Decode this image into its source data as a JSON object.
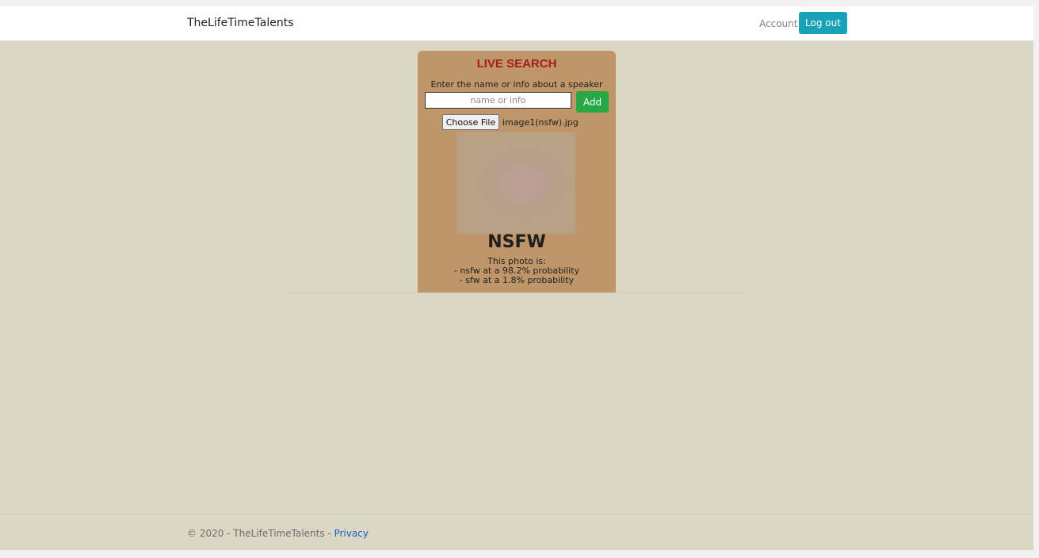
{
  "navbar": {
    "brand": "TheLifeTimeTalents",
    "account_link": "Account",
    "logout_label": "Log out",
    "logout_color": "#17a2b8"
  },
  "live_search": {
    "title": "LIVE SEARCH",
    "description": "Enter the name or info about a speaker",
    "input_placeholder": "name or info",
    "input_value": "",
    "add_label": "Add",
    "add_color": "#28a745",
    "file_button_label": "Choose File",
    "file_name": "image1(nsfw).jpg",
    "card_color": "#bf9669"
  },
  "result": {
    "verdict": "NSFW",
    "intro": "This photo is:",
    "line1": "- nsfw at a 98.2% probability",
    "line2": "- sfw at a 1.8% probability",
    "nsfw_probability": 98.2,
    "sfw_probability": 1.8
  },
  "footer": {
    "copyright": "© 2020 - TheLifeTimeTalents - ",
    "privacy_link": "Privacy"
  }
}
